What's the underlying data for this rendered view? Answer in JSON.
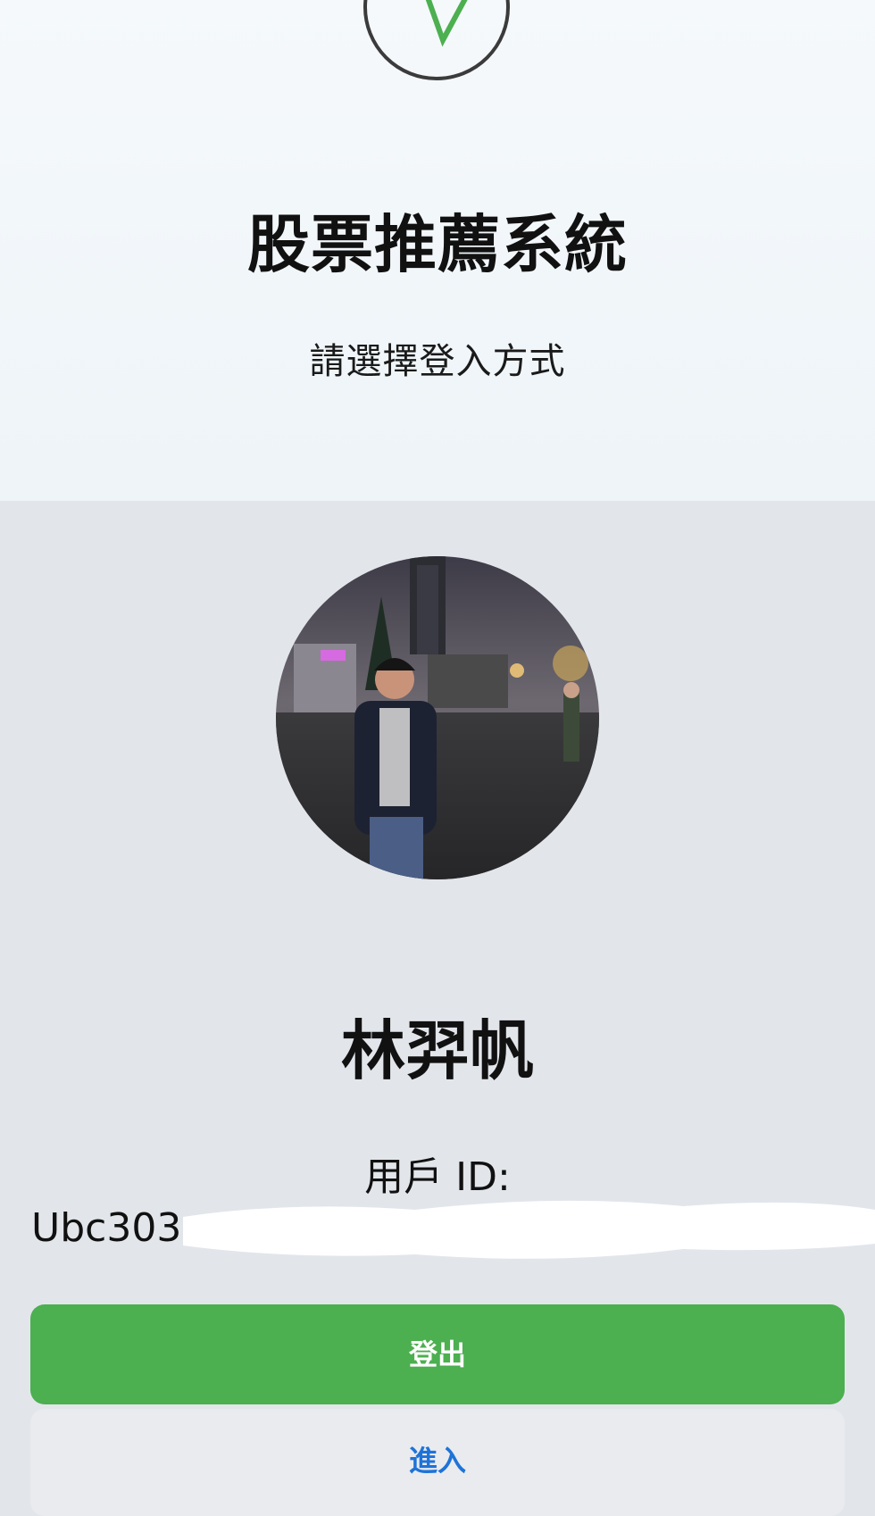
{
  "header": {
    "logo_icon": "stock-trend-logo-icon",
    "title": "股票推薦系統",
    "subtitle": "請選擇登入方式"
  },
  "profile": {
    "avatar_icon": "user-avatar-photo",
    "name": "林羿帆",
    "id_label": "用戶 ID:",
    "id_value": "Ubc303"
  },
  "actions": {
    "logout_label": "登出",
    "enter_label": "進入"
  },
  "colors": {
    "primary_green": "#4caf50",
    "link_blue": "#1e73d8",
    "panel_gray": "#e2e6eb"
  }
}
